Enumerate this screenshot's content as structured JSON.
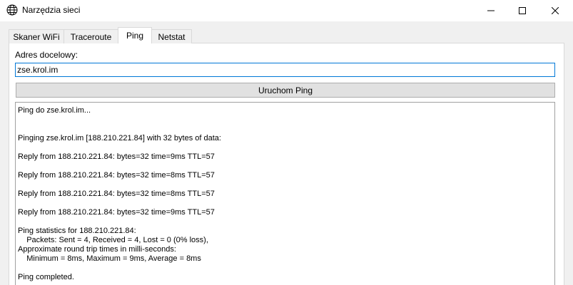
{
  "window": {
    "title": "Narzędzia sieci",
    "icon": "globe-icon"
  },
  "controls": {
    "minimize": "minimize-icon",
    "maximize": "maximize-icon",
    "close": "close-icon"
  },
  "tabs": [
    {
      "label": "Skaner WiFi",
      "active": false
    },
    {
      "label": "Traceroute",
      "active": false
    },
    {
      "label": "Ping",
      "active": true
    },
    {
      "label": "Netstat",
      "active": false
    }
  ],
  "ping": {
    "target_label": "Adres docelowy:",
    "target_value": "zse.krol.im",
    "run_label": "Uruchom Ping",
    "output_lines": [
      "Ping do zse.krol.im...",
      "",
      "",
      "Pinging zse.krol.im [188.210.221.84] with 32 bytes of data:",
      "",
      "Reply from 188.210.221.84: bytes=32 time=9ms TTL=57",
      "",
      "Reply from 188.210.221.84: bytes=32 time=8ms TTL=57",
      "",
      "Reply from 188.210.221.84: bytes=32 time=8ms TTL=57",
      "",
      "Reply from 188.210.221.84: bytes=32 time=9ms TTL=57",
      "",
      "Ping statistics for 188.210.221.84:",
      "    Packets: Sent = 4, Received = 4, Lost = 0 (0% loss),",
      "Approximate round trip times in milli-seconds:",
      "    Minimum = 8ms, Maximum = 9ms, Average = 8ms",
      "",
      "Ping completed."
    ]
  },
  "colors": {
    "focus_border": "#0078d7",
    "button_bg": "#e1e1e1"
  }
}
